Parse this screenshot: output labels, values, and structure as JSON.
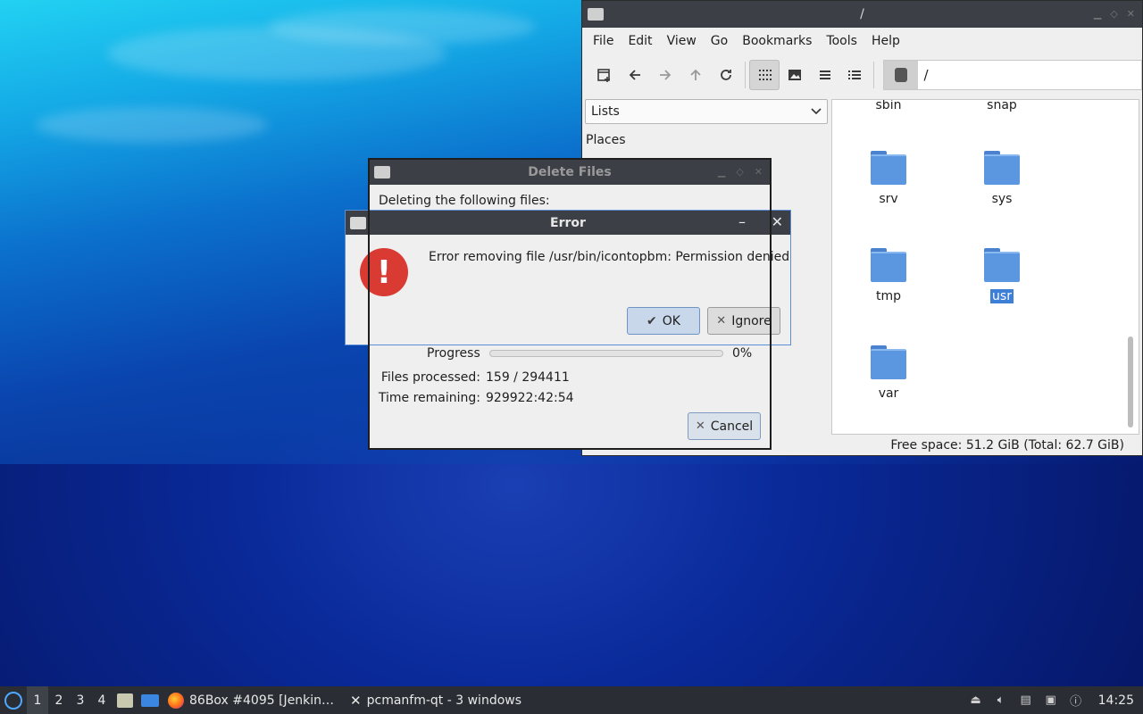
{
  "file_manager": {
    "title": "/",
    "menu": [
      "File",
      "Edit",
      "View",
      "Go",
      "Bookmarks",
      "Tools",
      "Help"
    ],
    "path": "/",
    "side_combo": "Lists",
    "places_label": "Places",
    "folders_top_partial": [
      "sbin",
      "snap"
    ],
    "folders": [
      "srv",
      "sys",
      "tmp",
      "usr",
      "var"
    ],
    "selected_folder": "usr",
    "status": "Free space: 51.2 GiB (Total: 62.7 GiB)"
  },
  "delete_dialog": {
    "title": "Delete Files",
    "heading": "Deleting the following files:",
    "progress_label": "Progress",
    "progress_value": 0,
    "progress_text": "0%",
    "files_processed_label": "Files processed:",
    "files_processed_value": "159 / 294411",
    "time_remaining_label": "Time remaining:",
    "time_remaining_value": "929922:42:54",
    "cancel_label": "Cancel"
  },
  "error_dialog": {
    "title": "Error",
    "message": "Error removing file /usr/bin/icontopbm: Permission denied",
    "ok_label": "OK",
    "ignore_label": "Ignore"
  },
  "taskbar": {
    "workspaces": [
      "1",
      "2",
      "3",
      "4"
    ],
    "active_workspace": "1",
    "tasks": [
      "86Box #4095 [Jenkin…",
      "pcmanfm-qt - 3 windows"
    ],
    "clock": "14:25"
  },
  "colors": {
    "accent": "#3d7fd6",
    "titlebar": "#3c3f45",
    "error_red": "#d93a32",
    "taskbar": "#2a2d33"
  }
}
